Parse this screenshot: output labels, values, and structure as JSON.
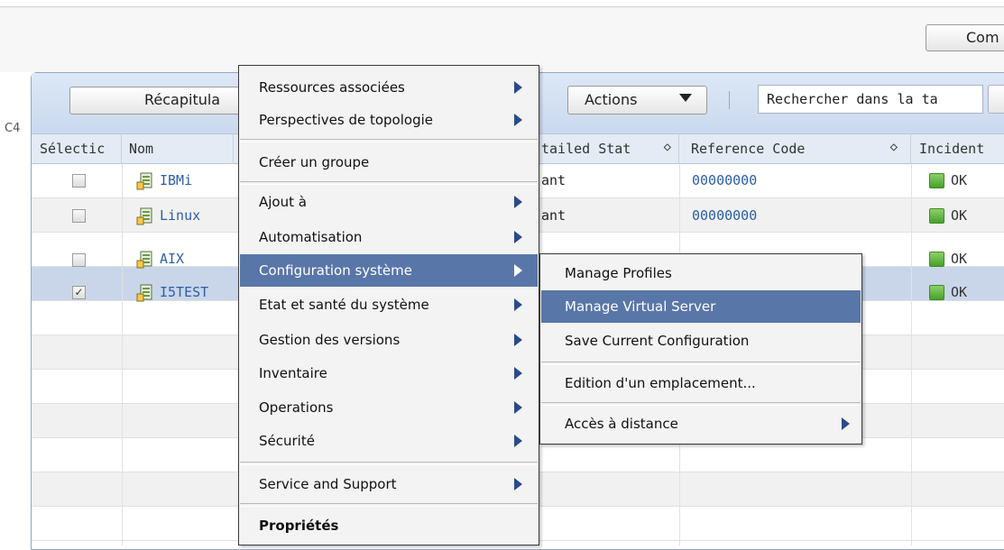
{
  "top": {
    "button_label": "Com"
  },
  "left_label": "C4",
  "toolbar": {
    "summary_button": "Récapitula",
    "actions_button": "Actions",
    "search_text": "Rechercher dans la ta"
  },
  "table": {
    "headers": {
      "select": "Sélectic",
      "name": "Nom",
      "detailed_status": "tailed Stat",
      "reference_code": "Reference Code",
      "incidents": "Incident"
    },
    "sort_glyph": "◇",
    "rows": [
      {
        "name": "IBMi",
        "status": "ant",
        "ref": "00000000",
        "incident": "OK",
        "checked": false
      },
      {
        "name": "Linux",
        "status": "ant",
        "ref": "00000000",
        "incident": "OK",
        "checked": false
      },
      {
        "name": "AIX",
        "status": "",
        "ref": "",
        "incident": "OK",
        "checked": false
      },
      {
        "name": "I5TEST",
        "status": "",
        "ref": "",
        "incident": "OK",
        "checked": true
      }
    ],
    "check_glyph": "✓"
  },
  "context_menu": {
    "items": [
      "Ressources associées",
      "Perspectives de topologie",
      "Créer un groupe",
      "Ajout à",
      "Automatisation",
      "Configuration système",
      "Etat et santé du système",
      "Gestion des versions",
      "Inventaire",
      "Operations",
      "Sécurité",
      "Service and Support",
      "Propriétés"
    ],
    "highlighted": "Configuration système"
  },
  "submenu": {
    "items": [
      "Manage Profiles",
      "Manage Virtual Server",
      "Save Current Configuration",
      "Edition d'un emplacement...",
      "Accès à distance"
    ],
    "highlighted": "Manage Virtual Server"
  },
  "colors": {
    "menu_highlight": "#5976a8",
    "link": "#2c5ea8",
    "status_ok": "#46a12a"
  }
}
